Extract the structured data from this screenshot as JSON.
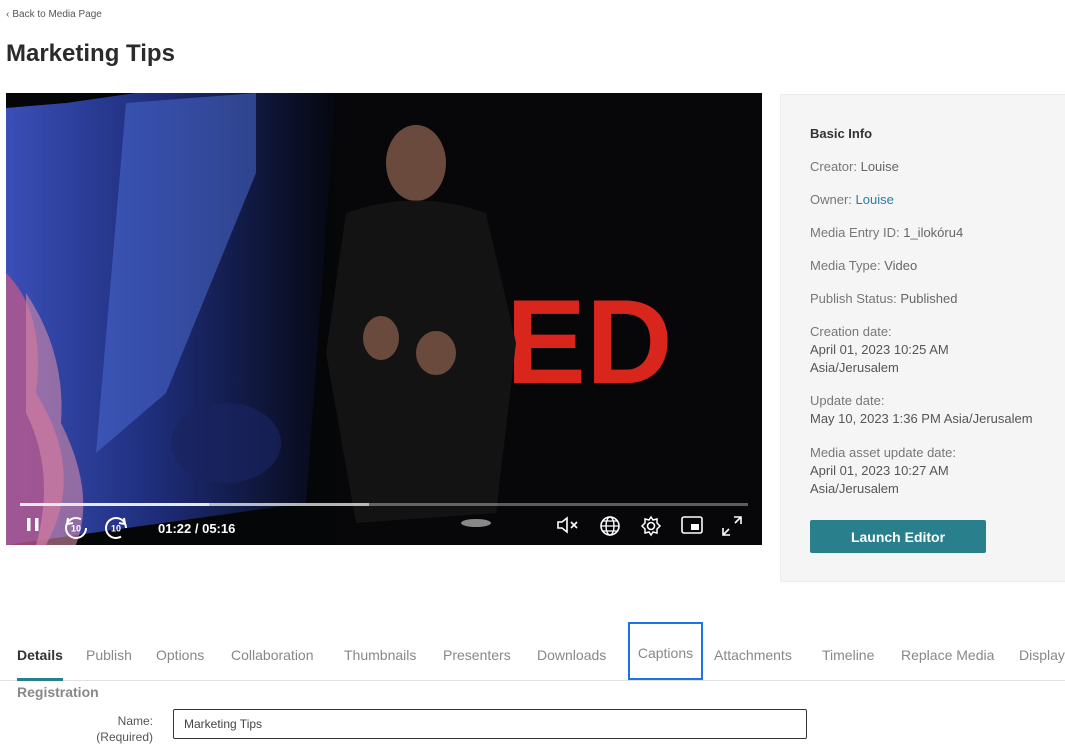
{
  "nav": {
    "back_label": "Back to Media Page"
  },
  "page": {
    "title": "Marketing Tips"
  },
  "player": {
    "time": "01:22 / 05:16",
    "played_fraction": 0.26,
    "buffered_fraction": 0.48,
    "stage_text": "ED"
  },
  "info": {
    "heading": "Basic Info",
    "creator_label": "Creator:",
    "creator": "Louise",
    "owner_label": "Owner:",
    "owner": "Louise",
    "entry_id_label": "Media Entry ID:",
    "entry_id": "1_ilokóru4",
    "media_type_label": "Media Type:",
    "media_type": "Video",
    "publish_status_label": "Publish Status:",
    "publish_status": "Published",
    "creation_label": "Creation date:",
    "creation_date": "April 01, 2023 10:25 AM Asia/Jerusalem",
    "update_label": "Update date:",
    "update_date": "May 10, 2023 1:36 PM Asia/Jerusalem",
    "asset_update_label": "Media asset update date:",
    "asset_update_date": "April 01, 2023 10:27 AM Asia/Jerusalem",
    "launch_label": "Launch Editor"
  },
  "tabs": [
    {
      "label": "Details"
    },
    {
      "label": "Publish"
    },
    {
      "label": "Options"
    },
    {
      "label": "Collaboration"
    },
    {
      "label": "Thumbnails"
    },
    {
      "label": "Presenters"
    },
    {
      "label": "Downloads"
    },
    {
      "label": "Captions"
    },
    {
      "label": "Attachments"
    },
    {
      "label": "Timeline"
    },
    {
      "label": "Replace Media"
    },
    {
      "label": "Display"
    }
  ],
  "form": {
    "section": "Registration",
    "name_label": "Name:",
    "name_required": "(Required)",
    "name_value": "Marketing Tips"
  },
  "colors": {
    "accent": "#2a7f8c",
    "focus": "#1a73e8"
  }
}
